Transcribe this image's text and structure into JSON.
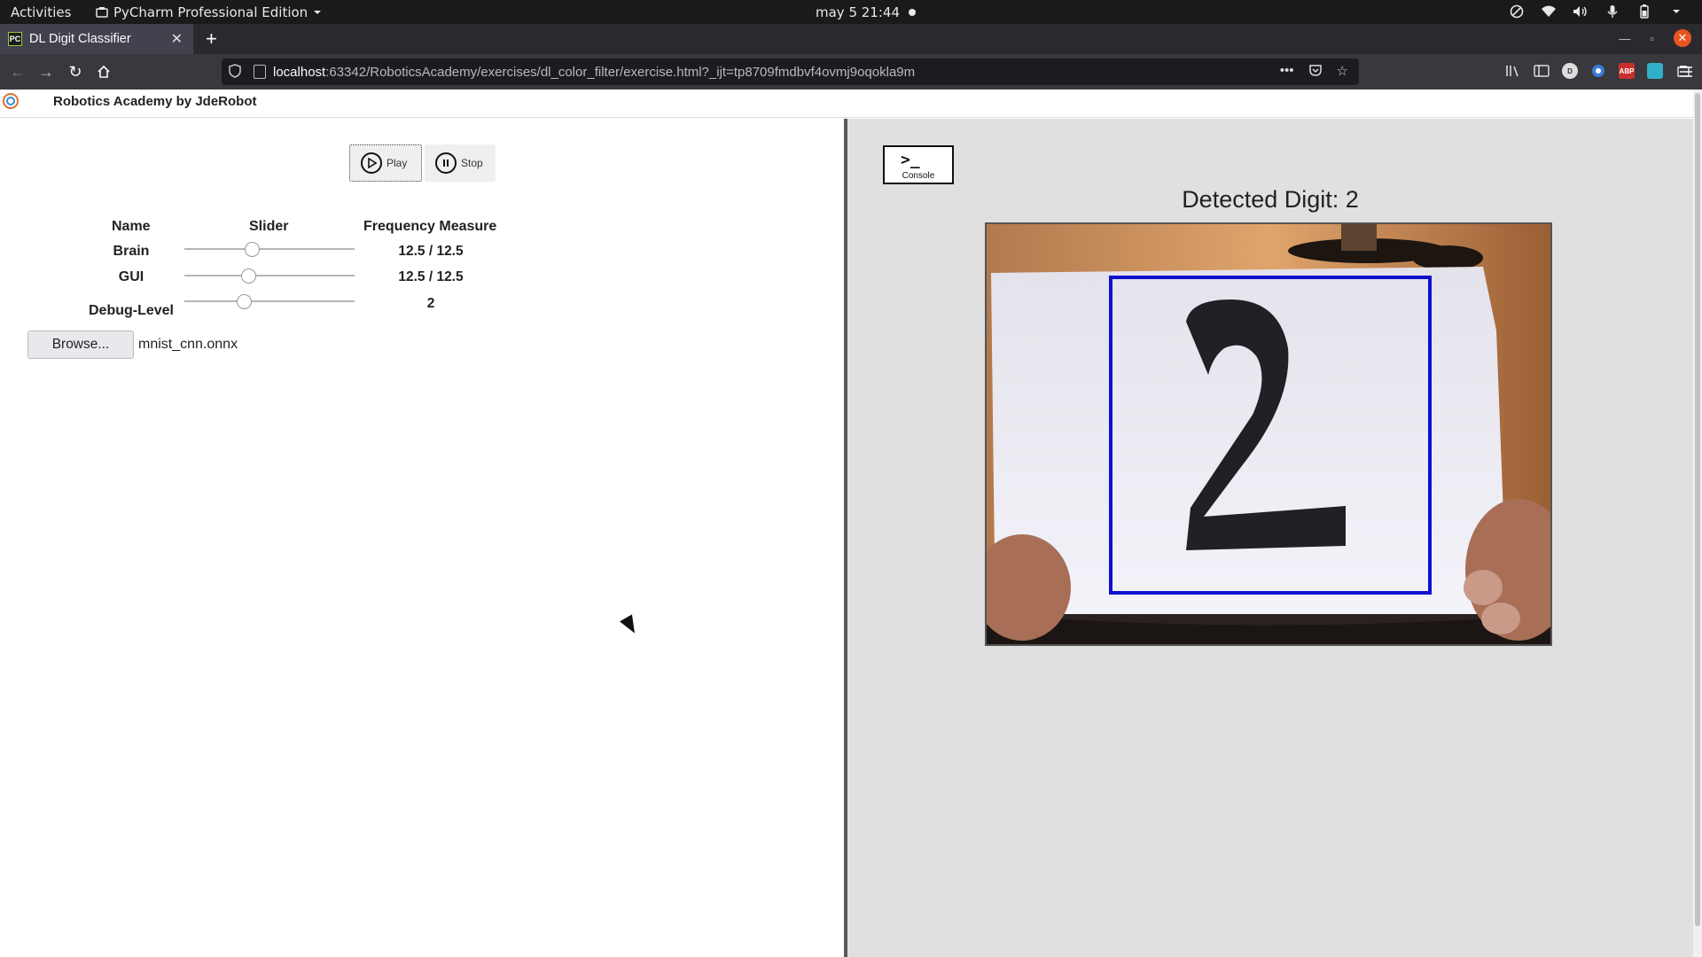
{
  "system_bar": {
    "activities": "Activities",
    "app_name": "PyCharm Professional Edition",
    "clock": "may 5  21:44"
  },
  "browser": {
    "tab_title": "DL Digit Classifier",
    "url_host": "localhost",
    "url_rest": ":63342/RoboticsAcademy/exercises/dl_color_filter/exercise.html?_ijt=tp8709fmdbvf4ovmj9oqokla9m",
    "extensions": [
      "library-icon",
      "sidebar-icon",
      "account-icon",
      "extension-icon",
      "adblock-icon",
      "save-icon",
      "screenshot-icon"
    ],
    "abp_label": "ABP"
  },
  "app": {
    "title": "Robotics Academy by JdeRobot"
  },
  "controls": {
    "play_label": "Play",
    "stop_label": "Stop"
  },
  "frequency_table": {
    "headers": {
      "name": "Name",
      "slider": "Slider",
      "measure": "Frequency Measure"
    },
    "rows": [
      {
        "name": "Brain",
        "value": "12.5 / 12.5",
        "slider_level": 0.4
      },
      {
        "name": "GUI",
        "value": "12.5 / 12.5",
        "slider_level": 0.38
      },
      {
        "name": "Debug-Level",
        "value": "2",
        "slider_level": 0.35
      }
    ]
  },
  "model_file": {
    "browse_label": "Browse...",
    "filename": "mnist_cnn.onnx"
  },
  "right_panel": {
    "console_label": "Console",
    "detected_text": "Detected Digit: 2",
    "box_color": "#1010d0"
  },
  "colors": {
    "page_background_right": "#e0e0e0",
    "accent_close": "#e95420"
  }
}
